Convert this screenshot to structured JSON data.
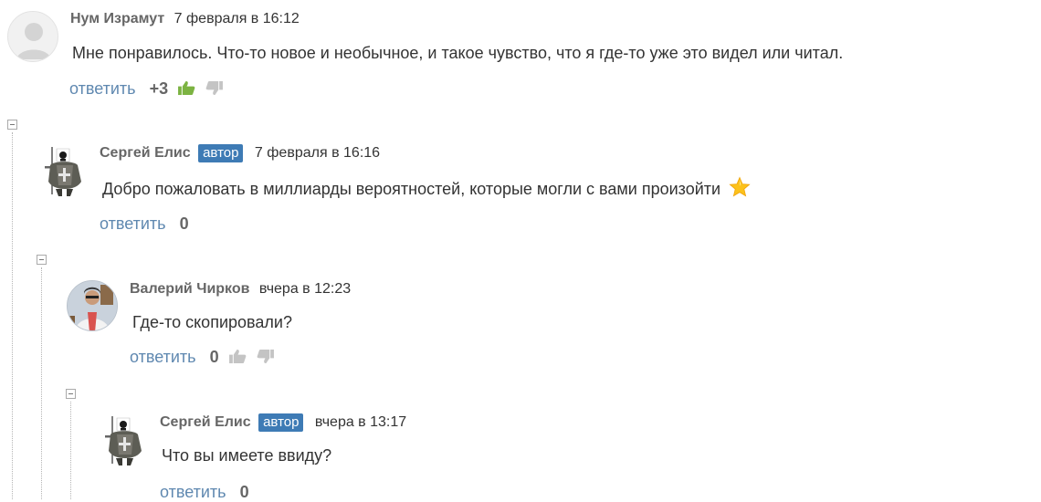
{
  "comments": [
    {
      "author": "Нум Израмут",
      "badge": "",
      "date": "7 февраля в 16:12",
      "text": "Мне понравилось. Что-то новое и необычное, и такое чувство, что я где-то уже это видел или читал.",
      "reply_label": "ответить",
      "rating": "+3",
      "avatar": "default-avatar-icon"
    },
    {
      "author": "Сергей Елис",
      "badge": "автор",
      "date": "7 февраля в 16:16",
      "text": "Добро пожаловать в миллиарды вероятностей, которые могли с вами произойти",
      "emoji": "star-emoji-icon",
      "reply_label": "ответить",
      "rating": "0",
      "avatar": "knight-avatar-icon"
    },
    {
      "author": "Валерий Чирков",
      "badge": "",
      "date": "вчера в 12:23",
      "text": "Где-то скопировали?",
      "reply_label": "ответить",
      "rating": "0",
      "avatar": "user-photo-avatar"
    },
    {
      "author": "Сергей Елис",
      "badge": "автор",
      "date": "вчера в 13:17",
      "text": "Что вы имеете ввиду?",
      "reply_label": "ответить",
      "rating": "0",
      "avatar": "knight-avatar-icon"
    }
  ],
  "colors": {
    "link": "#5f88b0",
    "badge_bg": "#3e7bb5",
    "thumb_up_active": "#7cb342",
    "thumb_inactive": "#c4c4c4"
  }
}
